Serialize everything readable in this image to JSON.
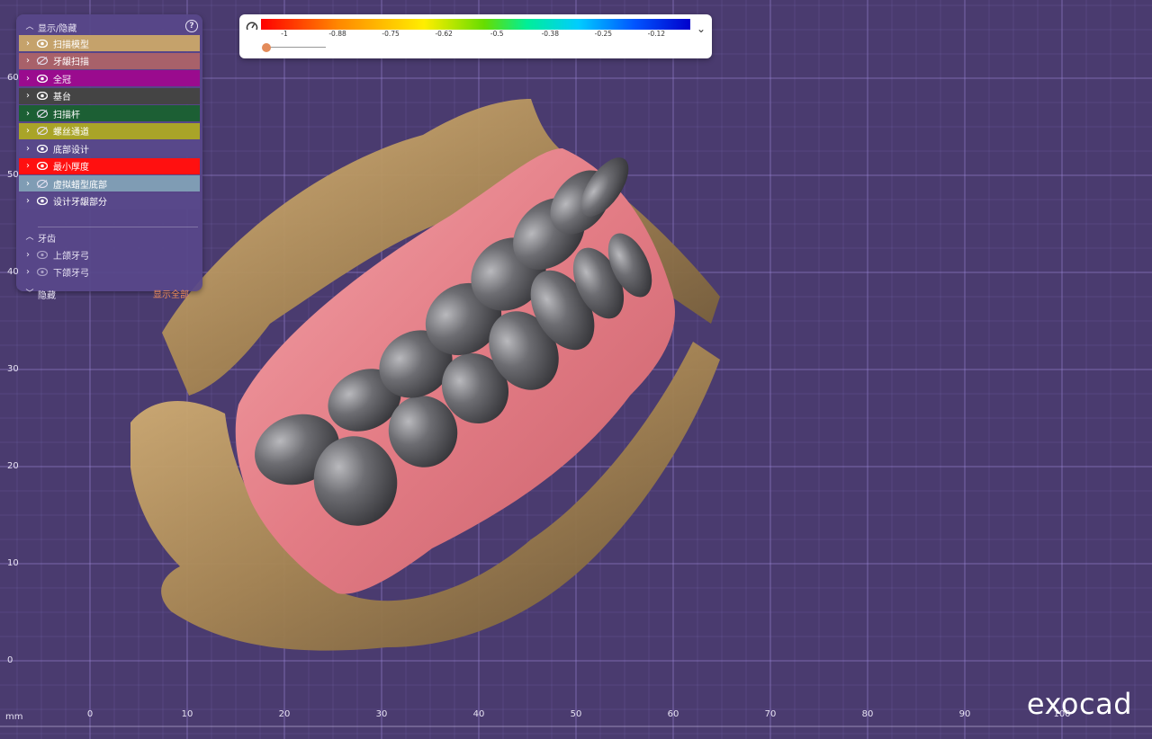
{
  "app": {
    "brand": "exocad"
  },
  "scene_panel": {
    "title": "显示/隐藏",
    "help_icon": "help-circle-icon",
    "layers": [
      {
        "label": "扫描模型",
        "visible": true,
        "color": "#c5a26b"
      },
      {
        "label": "牙龈扫描",
        "visible": false,
        "color": "#a8616a"
      },
      {
        "label": "全冠",
        "visible": true,
        "color": "#9a0b8e"
      },
      {
        "label": "基台",
        "visible": true,
        "color": "#444444"
      },
      {
        "label": "扫描杆",
        "visible": false,
        "color": "#1c5f34"
      },
      {
        "label": "螺丝通道",
        "visible": false,
        "color": "#a9a428"
      },
      {
        "label": "底部设计",
        "visible": true,
        "color": "#58488a"
      },
      {
        "label": "最小厚度",
        "visible": true,
        "color": "#ff1010"
      },
      {
        "label": "虚拟蜡型底部",
        "visible": false,
        "color": "#7f9cb4"
      },
      {
        "label": "设计牙龈部分",
        "visible": true,
        "color": "#58488a"
      }
    ],
    "teeth_section": {
      "title": "牙齿",
      "items": [
        {
          "label": "上颌牙弓"
        },
        {
          "label": "下颌牙弓"
        }
      ]
    },
    "hidden_section": {
      "title": "隐藏",
      "show_all_label": "显示全部"
    }
  },
  "color_legend": {
    "gauge_icon": "gauge-icon",
    "ticks": [
      "-1",
      "-0.88",
      "-0.75",
      "-0.62",
      "-0.5",
      "-0.38",
      "-0.25",
      "-0.12"
    ],
    "slider_value": 0,
    "toggle_icon": "chevron-down-icon"
  },
  "axes": {
    "unit": "mm",
    "x_ticks": [
      "0",
      "10",
      "20",
      "30",
      "40",
      "50",
      "60",
      "70",
      "80",
      "90",
      "100"
    ],
    "y_ticks": [
      "0",
      "10",
      "20",
      "30",
      "40",
      "50",
      "60"
    ]
  }
}
